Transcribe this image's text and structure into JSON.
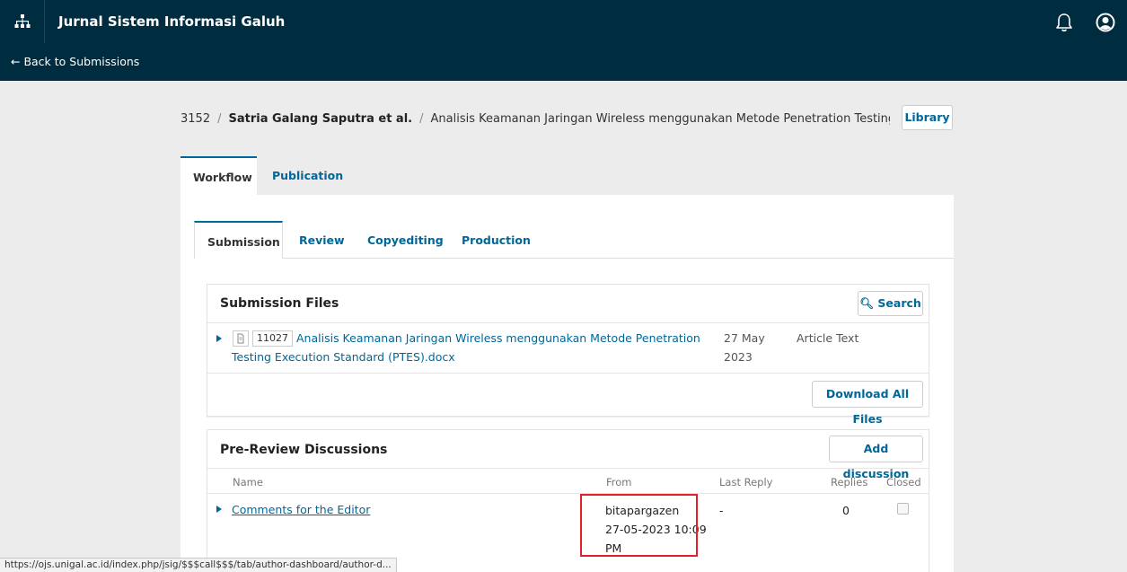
{
  "header": {
    "site_title": "Jurnal Sistem Informasi Galuh",
    "back_link": "← Back to Submissions",
    "icons": {
      "left": "sitemap-icon",
      "notifications": "bell-icon",
      "user": "user-circle-icon"
    }
  },
  "breadcrumb": {
    "id": "3152",
    "sep1": "/",
    "authors": "Satria Galang Saputra et al.",
    "sep2": "/",
    "title": "Analisis Keamanan Jaringan Wireless menggunakan Metode Penetration Testing Execution Standard (PTES)",
    "library_label": "Library"
  },
  "tabs": {
    "workflow": "Workflow",
    "publication": "Publication"
  },
  "stage_tabs": {
    "submission": "Submission",
    "review": "Review",
    "copyediting": "Copyediting",
    "production": "Production"
  },
  "submission_files": {
    "title": "Submission Files",
    "search_label": "Search",
    "file": {
      "id": "11027",
      "name_line1": "Analisis Keamanan Jaringan Wireless menggunakan Metode Penetration",
      "name_line2": "Testing Execution Standard (PTES).docx",
      "date_line1": "27 May",
      "date_line2": "2023",
      "type": "Article Text"
    },
    "download_label": "Download All Files"
  },
  "discussions": {
    "title": "Pre-Review Discussions",
    "add_label": "Add discussion",
    "columns": {
      "name": "Name",
      "from": "From",
      "last_reply": "Last Reply",
      "replies": "Replies",
      "closed": "Closed"
    },
    "rows": [
      {
        "name": "Comments for the Editor",
        "from_user": "bitapargazen",
        "from_date_line1": "27-05-2023 10:09",
        "from_date_line2": "PM",
        "last_reply": "-",
        "replies": "0",
        "closed": false
      }
    ]
  },
  "status_url": "https://ojs.unigal.ac.id/index.php/jsig/$$$call$$$/tab/author-dashboard/author-d...",
  "colors": {
    "header_bg": "#002c40",
    "link": "#006798",
    "highlight": "#e0202a"
  }
}
